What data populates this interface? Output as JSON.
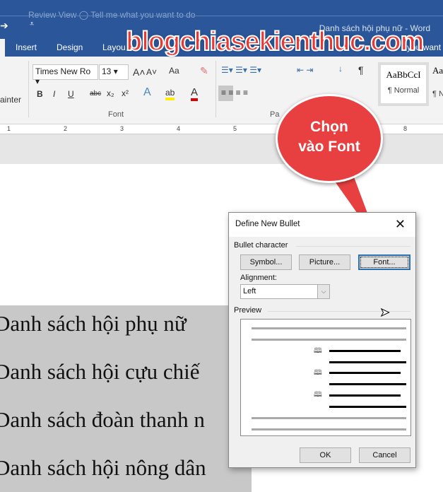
{
  "window": {
    "title": "Danh sách hội phụ nữ - Word",
    "faint_tabs": "Review    View    ◯ Tell me what you want to do"
  },
  "tabs": [
    "Insert",
    "Design",
    "Layou",
    "you want"
  ],
  "watermark": "blogchiasekienthuc.com",
  "ribbon": {
    "clipboard_label": "ainter",
    "font_name": "Times New Ro",
    "font_size": "13",
    "change_case": "Aa",
    "bold": "B",
    "italic": "I",
    "underline": "U",
    "strike": "abc",
    "subscript": "x₂",
    "superscript": "x²",
    "font_group": "Font",
    "paragraph_group": "Pa",
    "style_preview": "AaBbCcI",
    "style_name": "¶ Normal",
    "style2_preview": "Aa",
    "style2_name": "¶ N",
    "pilcrow": "¶"
  },
  "ruler": [
    "1",
    "2",
    "3",
    "4",
    "5",
    "8"
  ],
  "callout": {
    "line1": "Chọn",
    "line2": "vào Font"
  },
  "document": {
    "lines": [
      "Danh sách hội phụ nữ",
      "Danh sách hội cựu chiế",
      "Danh sách đoàn thanh n",
      "Danh sách hội nông dân"
    ]
  },
  "dialog": {
    "title": "Define New Bullet",
    "close": "✕",
    "section_bullet": "Bullet character",
    "symbol_button": "Symbol...",
    "picture_button": "Picture...",
    "font_button": "Font...",
    "alignment_label": "Alignment:",
    "alignment_value": "Left",
    "section_preview": "Preview",
    "preview_bullet": "🕮",
    "ok": "OK",
    "cancel": "Cancel"
  }
}
